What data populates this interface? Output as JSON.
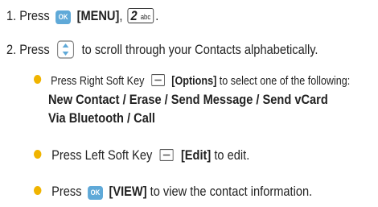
{
  "step1": {
    "prefix": "1. Press",
    "ok_key_label": "OK",
    "menu_label": "[MENU]",
    "comma": ",",
    "key2_number": "2",
    "key2_letters": "abc",
    "end": "."
  },
  "step2": {
    "prefix": "2. Press",
    "nav_icon": "up-down-navigation-key-icon",
    "text": "to scroll through your Contacts alphabetically."
  },
  "bullet1": {
    "prefix": "Press Right Soft Key",
    "soft_icon": "right-soft-key-icon",
    "options_label": "[Options]",
    "suffix": "to select one of the following:",
    "line2_parts": [
      "New Contact",
      "Erase",
      "Send Message",
      "Send vCard"
    ],
    "line3_parts": [
      "Via Bluetooth",
      "Call"
    ],
    "separator": " / "
  },
  "bullet2": {
    "prefix": "Press Left Soft Key",
    "soft_icon": "left-soft-key-icon",
    "edit_label": "[Edit]",
    "suffix": "to edit."
  },
  "bullet3": {
    "prefix": "Press",
    "ok_key_label": "OK",
    "view_label": "[VIEW]",
    "suffix": "to view the contact information."
  },
  "colors": {
    "bullet": "#f0b400",
    "ok_key": "#5fa9d8",
    "nav_key": "#5fa9d8"
  }
}
